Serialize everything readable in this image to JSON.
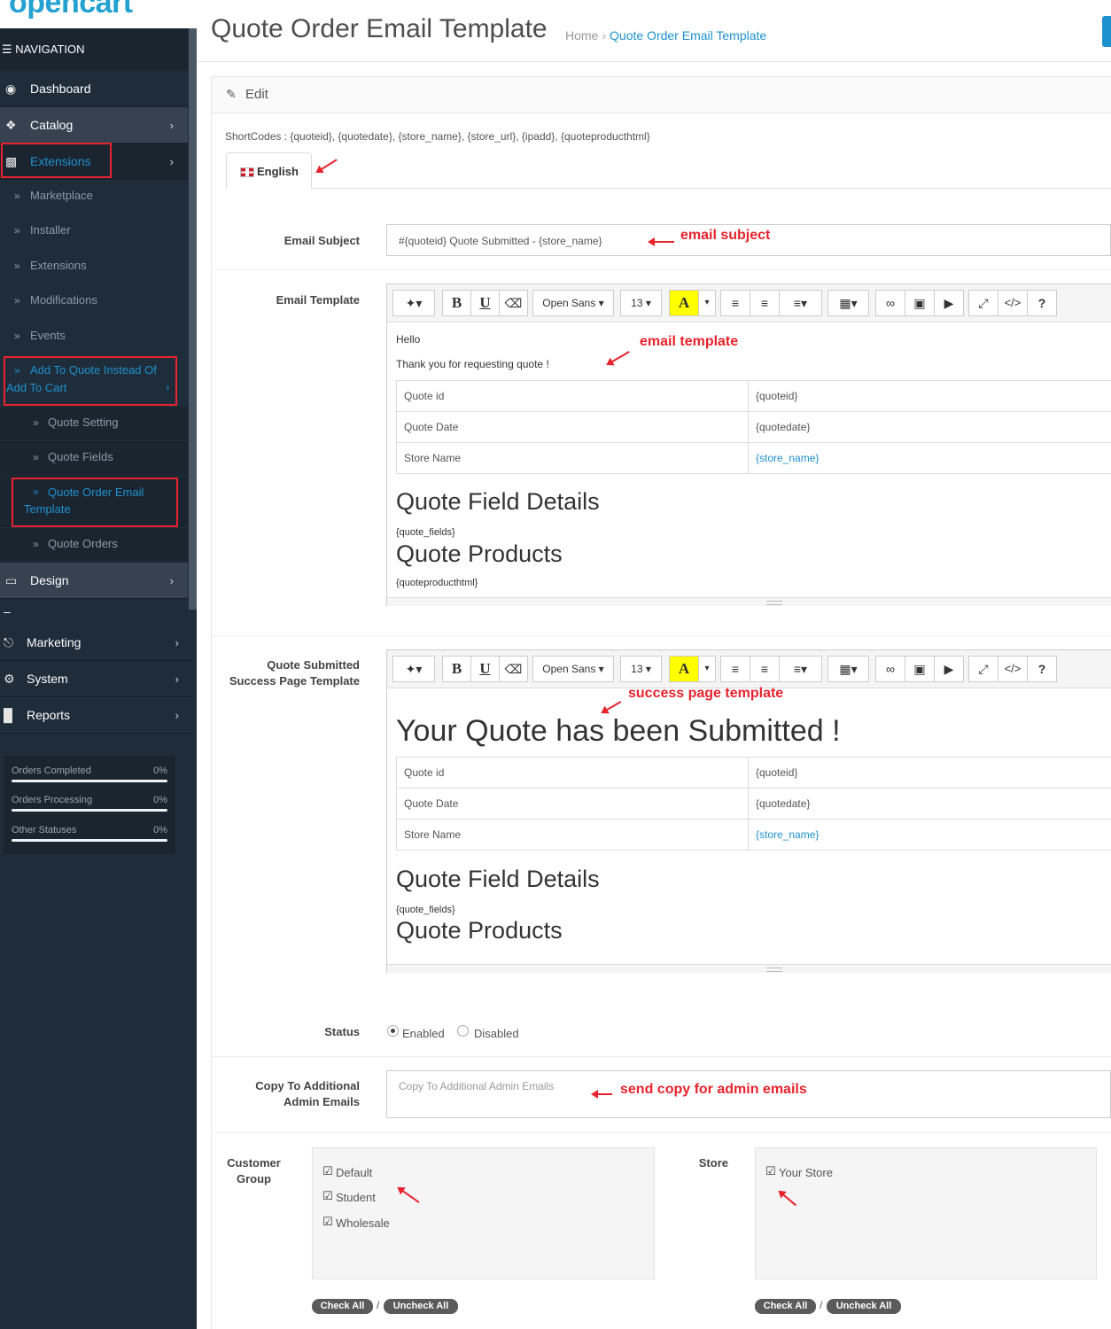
{
  "logo": {
    "text": "opencart"
  },
  "nav": {
    "header": "NAVIGATION",
    "items": {
      "dashboard": "Dashboard",
      "catalog": "Catalog",
      "extensions": "Extensions",
      "design": "Design",
      "marketing": "Marketing",
      "system": "System",
      "reports": "Reports"
    },
    "extensions_sub": {
      "marketplace": "Marketplace",
      "installer": "Installer",
      "extensions": "Extensions",
      "modifications": "Modifications",
      "events": "Events",
      "add_to_quote_1": "Add To Quote Instead Of",
      "add_to_quote_2": "Add To Cart"
    },
    "quote_sub": {
      "quote_setting": "Quote Setting",
      "quote_fields": "Quote Fields",
      "quote_order_email_1": "Quote Order Email",
      "quote_order_email_2": "Template",
      "quote_orders": "Quote Orders"
    },
    "dash": "–"
  },
  "stats": [
    {
      "label": "Orders Completed",
      "value": "0%"
    },
    {
      "label": "Orders Processing",
      "value": "0%"
    },
    {
      "label": "Other Statuses",
      "value": "0%"
    }
  ],
  "page": {
    "title": "Quote Order Email Template",
    "breadcrumb_home": "Home",
    "breadcrumb_current": "Quote Order Email Template",
    "panel_title": "Edit",
    "shortcodes": "ShortCodes : {quoteid}, {quotedate}, {store_name}, {store_url}, {ipadd}, {quoteproducthtml}",
    "tab_label": "English"
  },
  "form": {
    "email_subject_label": "Email Subject",
    "email_subject_value": "#{quoteid} Quote Submitted - {store_name}",
    "email_template_label": "Email Template",
    "success_label_1": "Quote Submitted",
    "success_label_2": "Success Page Template",
    "status_label": "Status",
    "status_enabled": "Enabled",
    "status_disabled": "Disabled",
    "copy_label_1": "Copy To Additional",
    "copy_label_2": "Admin Emails",
    "copy_placeholder": "Copy To Additional Admin Emails",
    "customer_group_label_1": "Customer",
    "customer_group_label_2": "Group",
    "customer_groups": [
      "Default",
      "Student",
      "Wholesale"
    ],
    "store_label": "Store",
    "stores": [
      "Your Store"
    ],
    "check_all": "Check All",
    "uncheck_all": "Uncheck All",
    "slash": "/"
  },
  "editor": {
    "font_name": "Open Sans",
    "font_size": "13",
    "bold": "B",
    "underline": "U",
    "highlight": "A",
    "help": "?",
    "code": "</>"
  },
  "email_template": {
    "hello": "Hello",
    "thanks": "Thank you for requesting quote !",
    "rows": [
      [
        "Quote id",
        "{quoteid}"
      ],
      [
        "Quote Date",
        "{quotedate}"
      ],
      [
        "Store Name",
        "{store_name}"
      ]
    ],
    "field_heading": "Quote Field Details",
    "field_code": "{quote_fields}",
    "products_heading": "Quote Products",
    "products_code": "{quoteproducthtml}"
  },
  "success_template": {
    "heading": "Your Quote has been Submitted !",
    "rows": [
      [
        "Quote id",
        "{quoteid}"
      ],
      [
        "Quote Date",
        "{quotedate}"
      ],
      [
        "Store Name",
        "{store_name}"
      ]
    ],
    "field_heading": "Quote Field Details",
    "field_code": "{quote_fields}",
    "products_heading": "Quote Products"
  },
  "annotations": {
    "email_subject": "email subject",
    "email_template": "email template",
    "success_page": "success page template",
    "admin_emails": "send copy for admin emails"
  },
  "colors": {
    "accent": "#1e91cf",
    "annotation": "#e8232d",
    "sidebar": "#1f2c3a"
  }
}
